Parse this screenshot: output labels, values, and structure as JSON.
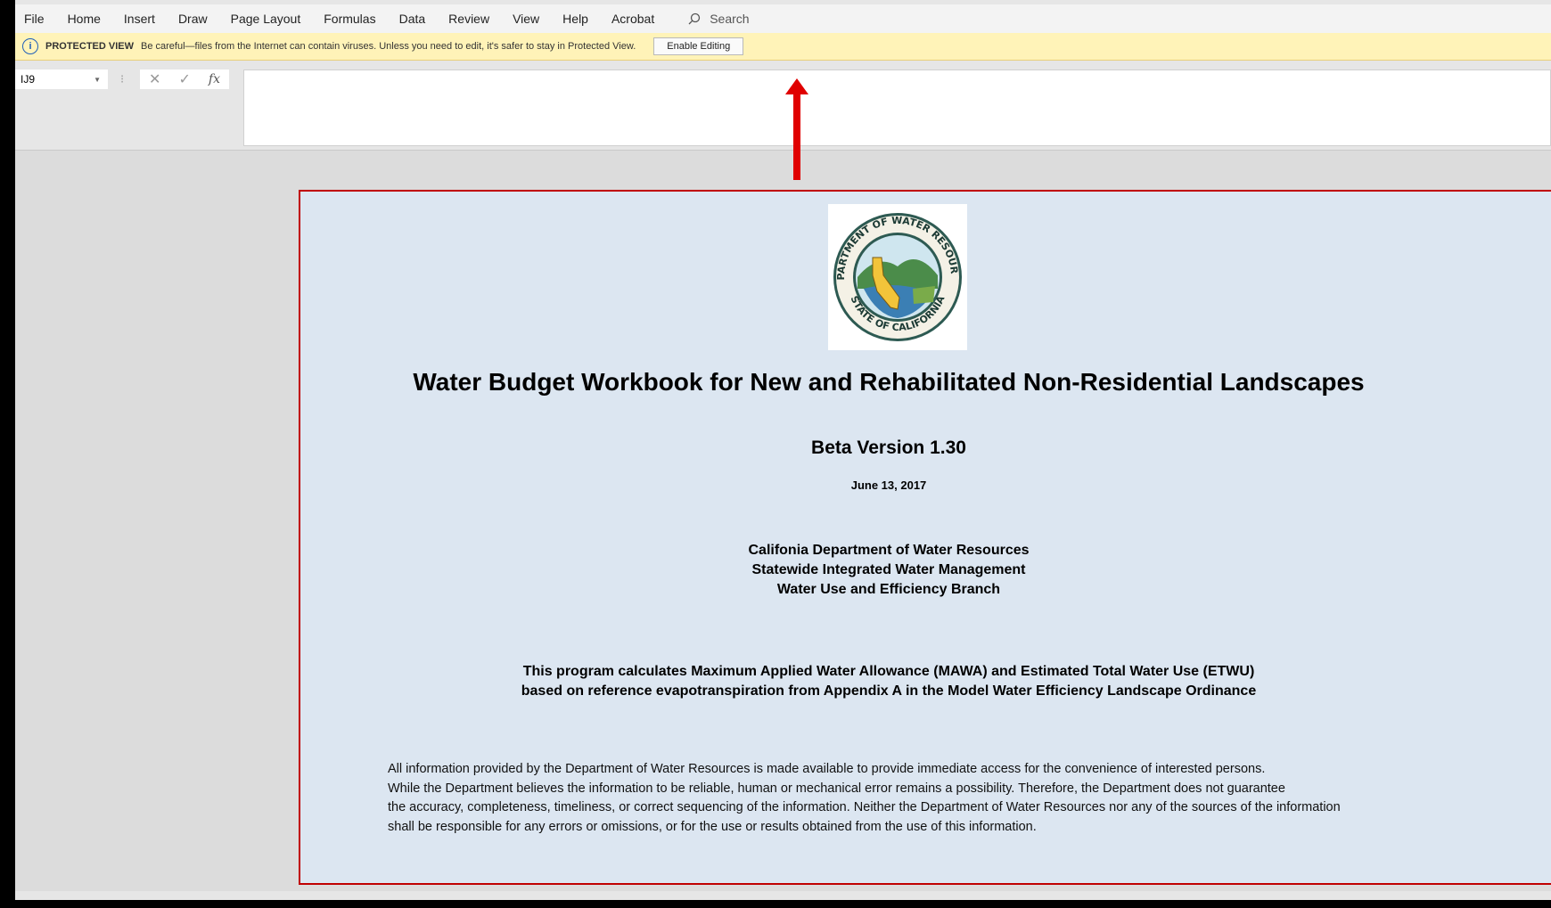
{
  "menu": [
    "File",
    "Home",
    "Insert",
    "Draw",
    "Page Layout",
    "Formulas",
    "Data",
    "Review",
    "View",
    "Help",
    "Acrobat"
  ],
  "search": {
    "label": "Search",
    "icon": "search-icon"
  },
  "protected_view": {
    "title": "PROTECTED VIEW",
    "message": "Be careful—files from the Internet can contain viruses. Unless you need to edit, it's safer to stay in Protected View.",
    "button": "Enable Editing",
    "bg_color": "#fff3b8"
  },
  "formula_bar": {
    "name_box": "IJ9",
    "fx": "fx",
    "value": ""
  },
  "content": {
    "title": "Water Budget Workbook for New and Rehabilitated Non-Residential Landscapes",
    "version": "Beta Version 1.30",
    "date": "June 13, 2017",
    "org": [
      "Califonia Department of  Water Resources",
      "Statewide Integrated Water Management",
      "Water Use and Efficiency Branch"
    ],
    "description": [
      "This program calculates Maximum Applied Water Allowance (MAWA) and Estimated Total Water Use (ETWU)",
      "based on reference evapotranspiration from Appendix A in the Model Water Efficiency Landscape Ordinance"
    ],
    "disclaimer": [
      "All information provided by the Department of Water Resources is made available to provide immediate access for the convenience of interested persons.",
      "While the Department believes the information to be reliable, human or mechanical error remains a possibility. Therefore, the Department does not guarantee",
      "the accuracy, completeness, timeliness, or correct sequencing of the information. Neither the Department of Water Resources nor any of the sources of the information",
      "shall be responsible for any errors or omissions, or for the use or results obtained from the use of this information."
    ],
    "seal_text": "DEPARTMENT OF WATER RESOURCES • STATE OF CALIFORNIA",
    "panel_border_color": "#c00000",
    "panel_bg": "#dce6f1"
  },
  "annotation": {
    "arrow_color": "#e00000"
  }
}
